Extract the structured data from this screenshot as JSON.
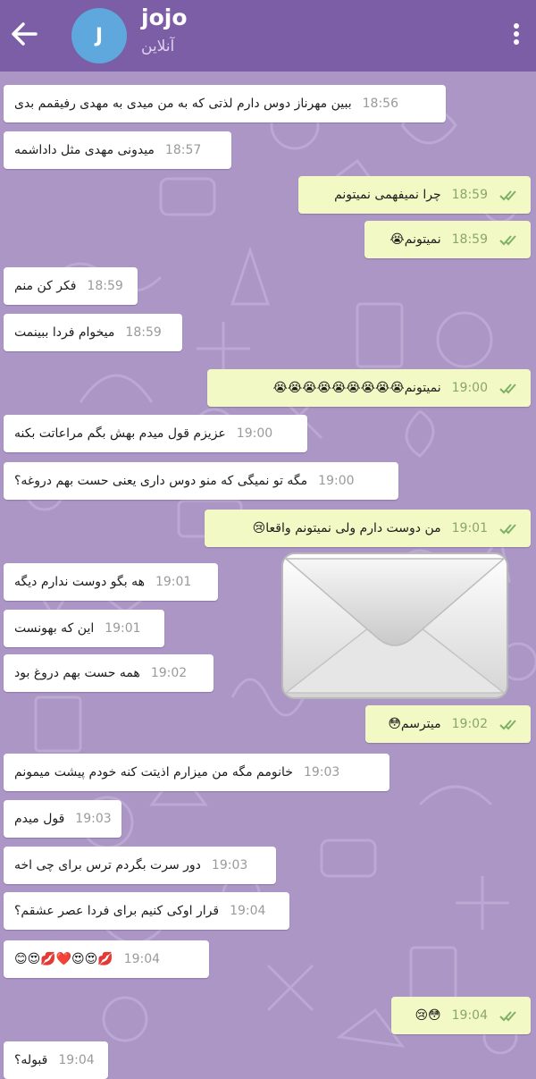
{
  "header": {
    "back_icon": "arrow-left-icon",
    "avatar_initial": "J",
    "name": "jojo",
    "status": "آنلاین",
    "menu_icon": "more-vertical-icon",
    "bar_color": "#7b5ea5",
    "avatar_color": "#5ea8de"
  },
  "wallpaper": {
    "color": "#ab96c5",
    "pattern": "doodle-icons"
  },
  "overlay": {
    "icon": "envelope-icon"
  },
  "bubble_colors": {
    "incoming": "#ffffff",
    "outgoing": "#f2f9c4",
    "check": "#7fb069"
  },
  "messages": [
    {
      "dir": "in",
      "text": "ببین مهرناز دوس دارم لذتی که به من میدی به مهدی رفیقمم بدی",
      "time": "18:56"
    },
    {
      "dir": "in",
      "text": "میدونی مهدی مثل داداشمه",
      "time": "18:57"
    },
    {
      "dir": "out",
      "text": "چرا نمیفهمی نمیتونم",
      "time": "18:59",
      "read": true
    },
    {
      "dir": "out",
      "text": "نمیتونم😭",
      "time": "18:59",
      "read": true
    },
    {
      "dir": "in",
      "text": "فکر کن منم",
      "time": "18:59"
    },
    {
      "dir": "in",
      "text": "میخوام فردا ببینمت",
      "time": "18:59"
    },
    {
      "dir": "out",
      "text": "نمیتونم😭😭😭😭😭😭😭😭😭",
      "time": "19:00",
      "read": true
    },
    {
      "dir": "in",
      "text": "عزیزم قول میدم بهش بگم مراعاتت بکنه",
      "time": "19:00"
    },
    {
      "dir": "in",
      "text": "مگه تو نمیگی که منو دوس داری یعنی حست بهم دروغه؟",
      "time": "19:00"
    },
    {
      "dir": "out",
      "text": "من دوست دارم ولی نمیتونم واقعا😢",
      "time": "19:01",
      "read": true
    },
    {
      "dir": "in",
      "text": "هه بگو دوست ندارم دیگه",
      "time": "19:01"
    },
    {
      "dir": "in",
      "text": "این که بهونست",
      "time": "19:01"
    },
    {
      "dir": "in",
      "text": "همه حست بهم دروغ بود",
      "time": "19:02"
    },
    {
      "dir": "out",
      "text": "میترسم😳",
      "time": "19:02",
      "read": true
    },
    {
      "dir": "in",
      "text": "خانومم مگه من میزارم اذیتت کنه خودم پیشت میمونم",
      "time": "19:03"
    },
    {
      "dir": "in",
      "text": "قول میدم",
      "time": "19:03"
    },
    {
      "dir": "in",
      "text": "دور سرت بگردم ترس برای چی اخه",
      "time": "19:03"
    },
    {
      "dir": "in",
      "text": "قرار اوکی کنیم برای فردا عصر عشقم؟",
      "time": "19:04"
    },
    {
      "dir": "in",
      "text": "💋😍😍❤️💋😍😊",
      "time": "19:04"
    },
    {
      "dir": "out",
      "text": "😳😢",
      "time": "19:04",
      "read": true
    },
    {
      "dir": "in",
      "text": "قبوله؟",
      "time": "19:04"
    }
  ]
}
